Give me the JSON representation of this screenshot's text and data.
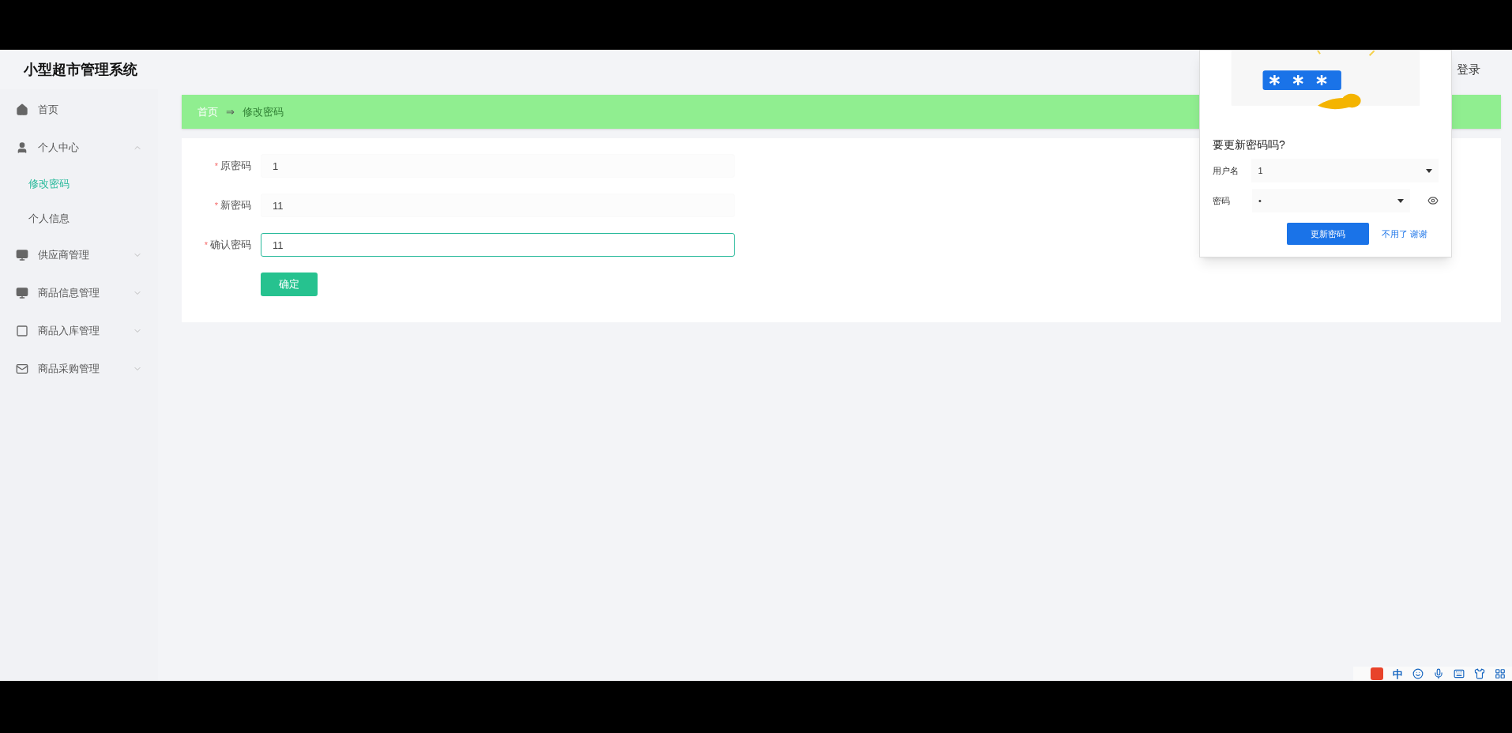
{
  "app_title": "小型超市管理系统",
  "header": {
    "login_link": "登录"
  },
  "sidebar": {
    "items": [
      {
        "label": "首页",
        "kind": "link"
      },
      {
        "label": "个人中心",
        "kind": "submenu",
        "expanded": true,
        "children": [
          {
            "label": "修改密码",
            "selected": true
          },
          {
            "label": "个人信息",
            "selected": false
          }
        ]
      },
      {
        "label": "供应商管理",
        "kind": "submenu",
        "expanded": false
      },
      {
        "label": "商品信息管理",
        "kind": "submenu",
        "expanded": false
      },
      {
        "label": "商品入库管理",
        "kind": "submenu",
        "expanded": false
      },
      {
        "label": "商品采购管理",
        "kind": "submenu",
        "expanded": false
      }
    ]
  },
  "breadcrumb": {
    "items": [
      "首页",
      "修改密码"
    ],
    "separator": "⇒"
  },
  "form": {
    "fields": [
      {
        "label": "原密码",
        "value": "1",
        "required_mark": "*",
        "focused": false
      },
      {
        "label": "新密码",
        "value": "11",
        "required_mark": "*",
        "focused": false
      },
      {
        "label": "确认密码",
        "value": "11",
        "required_mark": "*",
        "focused": true
      }
    ],
    "submit_button": "确定"
  },
  "password_popup": {
    "title": "要更新密码吗?",
    "fields": [
      {
        "label": "用户名",
        "value": "1",
        "kind": "text"
      },
      {
        "label": "密码",
        "value": "•",
        "kind": "password"
      }
    ],
    "primary_button": "更新密码",
    "secondary_button": "不用了 谢谢"
  },
  "ime_bar": {
    "mode_label": "中"
  }
}
